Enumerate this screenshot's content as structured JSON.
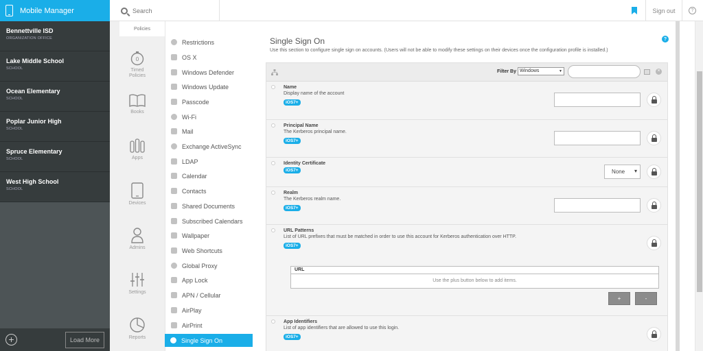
{
  "app": {
    "title": "Mobile Manager"
  },
  "topbar": {
    "search_placeholder": "Search",
    "signout_label": "Sign out",
    "help_glyph": "?"
  },
  "orgs": [
    {
      "name": "Bennettville ISD",
      "type": "ORGANIZATION OFFICE"
    },
    {
      "name": "Lake Middle School",
      "type": "SCHOOL"
    },
    {
      "name": "Ocean Elementary",
      "type": "SCHOOL"
    },
    {
      "name": "Poplar Junior High",
      "type": "SCHOOL"
    },
    {
      "name": "Spruce Elementary",
      "type": "SCHOOL"
    },
    {
      "name": "West High School",
      "type": "SCHOOL"
    }
  ],
  "orgs_footer": {
    "load_more": "Load More",
    "add_glyph": "+"
  },
  "nav": {
    "policies_tab": "Policies",
    "items": [
      {
        "line1": "Timed",
        "line2": "Policies",
        "icon": "timer-icon"
      },
      {
        "line1": "Books",
        "line2": "",
        "icon": "book-icon"
      },
      {
        "line1": "Apps",
        "line2": "",
        "icon": "apps-icon"
      },
      {
        "line1": "Devices",
        "line2": "",
        "icon": "tablet-icon"
      },
      {
        "line1": "Admins",
        "line2": "",
        "icon": "person-icon"
      },
      {
        "line1": "Settings",
        "line2": "",
        "icon": "sliders-icon"
      },
      {
        "line1": "Reports",
        "line2": "",
        "icon": "pie-chart-icon"
      }
    ]
  },
  "policies": [
    "Restrictions",
    "OS X",
    "Windows Defender",
    "Windows Update",
    "Passcode",
    "Wi-Fi",
    "Mail",
    "Exchange ActiveSync",
    "LDAP",
    "Calendar",
    "Contacts",
    "Shared Documents",
    "Subscribed Calendars",
    "Wallpaper",
    "Web Shortcuts",
    "Global Proxy",
    "App Lock",
    "APN / Cellular",
    "AirPlay",
    "AirPrint",
    "Single Sign On"
  ],
  "main": {
    "title": "Single Sign On",
    "description": "Use this section to configure single sign on accounts. (Users will not be able to modify these settings on their devices once the configuration profile is installed.)",
    "help_glyph": "?",
    "filter_label": "Filter By",
    "filter_value": "Windows",
    "badge": "iOS7+",
    "settings": {
      "name": {
        "label": "Name",
        "desc": "Display name of the account"
      },
      "principal": {
        "label": "Principal Name",
        "desc": "The Kerberos principal name."
      },
      "identity": {
        "label": "Identity Certificate",
        "value": "None"
      },
      "realm": {
        "label": "Realm",
        "desc": "The Kerberos realm name."
      },
      "url_patterns": {
        "label": "URL Patterns",
        "desc": "List of URL prefixes that must be matched in order to use this account for Kerberos authentication over HTTP.",
        "column": "URL",
        "empty": "Use the plus button below to add items.",
        "add": "+",
        "remove": "-"
      },
      "app_ids": {
        "label": "App Identifiers",
        "desc": "List of app identifiers that are allowed to use this login."
      }
    }
  },
  "colors": {
    "accent": "#1aaee8",
    "sidebar_dark": "#363c3d"
  }
}
